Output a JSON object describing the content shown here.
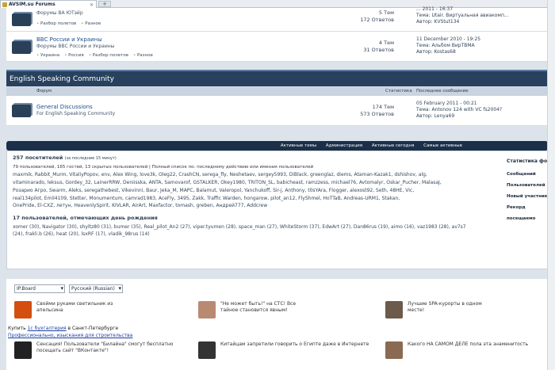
{
  "browser": {
    "tab_title": "AVSIM.su Forums",
    "new_tab": "+"
  },
  "forums_top": [
    {
      "name": "",
      "desc": "Форумы ВА ЮТэйр",
      "subs": [
        "Разбор полетов",
        "Разное"
      ],
      "topics": "5 Тем",
      "posts": "172 Ответов",
      "last_date": "... 2011 - 16:37",
      "last_topic": "Тема: Utair. Виртуальная авиакомп...",
      "last_author": "Автор: KVStut134"
    },
    {
      "name": "BBC России и Украины",
      "desc": "Форумы ВВС России и Украины",
      "subs": [
        "Украина",
        "Россия",
        "Разбор полетов",
        "Разное"
      ],
      "topics": "4 Тем",
      "posts": "31 Ответов",
      "last_date": "11 December 2010 - 19:25",
      "last_topic": "Тема: Альбом ВирТВМА",
      "last_author": "Автор: Kostas68"
    }
  ],
  "category": {
    "title": "English Speaking Community",
    "col_forum": "Форум",
    "col_stats": "Статистика",
    "col_last": "Последнее сообщение"
  },
  "forum_gd": {
    "name": "General Discussions",
    "desc": "For English Speaking Community",
    "topics": "174 Тем",
    "posts": "573 Ответов",
    "last_date": "05 February 2011 - 00:21",
    "last_topic": "Тема: Antonov 124 with VC fs2004?",
    "last_author": "Автор: Lenya69"
  },
  "navbar": {
    "links": [
      "Активные темы",
      "Администрация",
      "Активные сегодня",
      "Самые активные"
    ]
  },
  "stats": {
    "visitors_title": "257 посетителей",
    "visitors_note": "(за последние 15 минут)",
    "visitors_sub": "79 пользователей, 165 гостей, 13 скрытых пользователей | Полный список по: последнему действию или именам пользователей",
    "users_line1": "maxmik, Rabbit_Murm, VitaliyPopov, env, Alex Wing, love3k, Oleg22, CrashCN, serega_fly, Neshetaev, sergey5993, DiBlack, greenglaz, diems, Ataman-Kazak1, dshishov, alg,",
    "users_line2": "vitaminarado, leksus, Gordey_32, LainerRRW, Deniisska, ANTA, Samovarof, GSTALKER, Okey1980, TRITON_SL, babicheast, ramzzess, michael76, Avtomalyr, Oskar_Pucher, MalasaJ,",
    "users_line3": "Розарио Агро, Swarm, Aleks, seregathebest, Vikevinni, Baur, Jeka_M, MAPC, Balamut, Valeropol, Yanchukoff, Sir-j, Anthony, t0sYAra, Flogger, alexost92, Seth, 48HE, Vic,",
    "users_line4": "real134pilot, Emil4109, Stetter, Monumentum, camrad1983, AceFly, 3495, Zakk, Traffic Warden, hongarow, pilot_an12, FlyShmel, HoTTaB, Andreas-URM1, Stakan,",
    "users_line5": "OnePride, El-CXZ, летун, HeavenlySpirit, KIVLAR, AirArt, Maxfactor, tomash, greben, Андрей777, Addcrew",
    "birthday_title": "17 пользователей, отмечающих день рождения",
    "birthday_line1": "xomer (30), Navigator (30), shyltz80 (31), bumer (35), Real_pilot_An2 (27), viper.tyumen (28), space_man (27), WhiteStorm (37), EdwArt (27), Dan86rus (19), aimo (16), vaz1983 (28), av7s7",
    "birthday_line2": "(24), frakli.b (26), heat (20), lsxRF (17), vladik_98rus (14)",
    "side_title": "Статистика фору",
    "side_items": [
      "Сообщений",
      "Пользователей",
      "Новый участник",
      "Рекорд посещаемо"
    ]
  },
  "footer": {
    "skin": "IP.Board",
    "lang": "Русский (Russian)",
    "ads": [
      {
        "text": "Свойми руками светильник из апельсина"
      },
      {
        "text": "\"Не может быть!\" на СТС! Все тайное становится явным!"
      },
      {
        "text": "Лучшие SPA-курорты в одном месте!"
      },
      {
        "text": "Сенсация! Пользователи \"Билайна\" смогут бесплатно посещать сайт \"ВКонтакте\"!"
      },
      {
        "text": "Китайцам запретили говорить о Египте даже в Интернете"
      },
      {
        "text": "Какого НА САМОМ ДЕЛЕ пола эта знаменитость"
      }
    ],
    "text_link1_a": "Купить",
    "text_link1_b": "1с бухгалтерия",
    "text_link1_c": "в Санкт-Петербурге",
    "text_link2": "Профессионально, изыскания для строительства"
  }
}
